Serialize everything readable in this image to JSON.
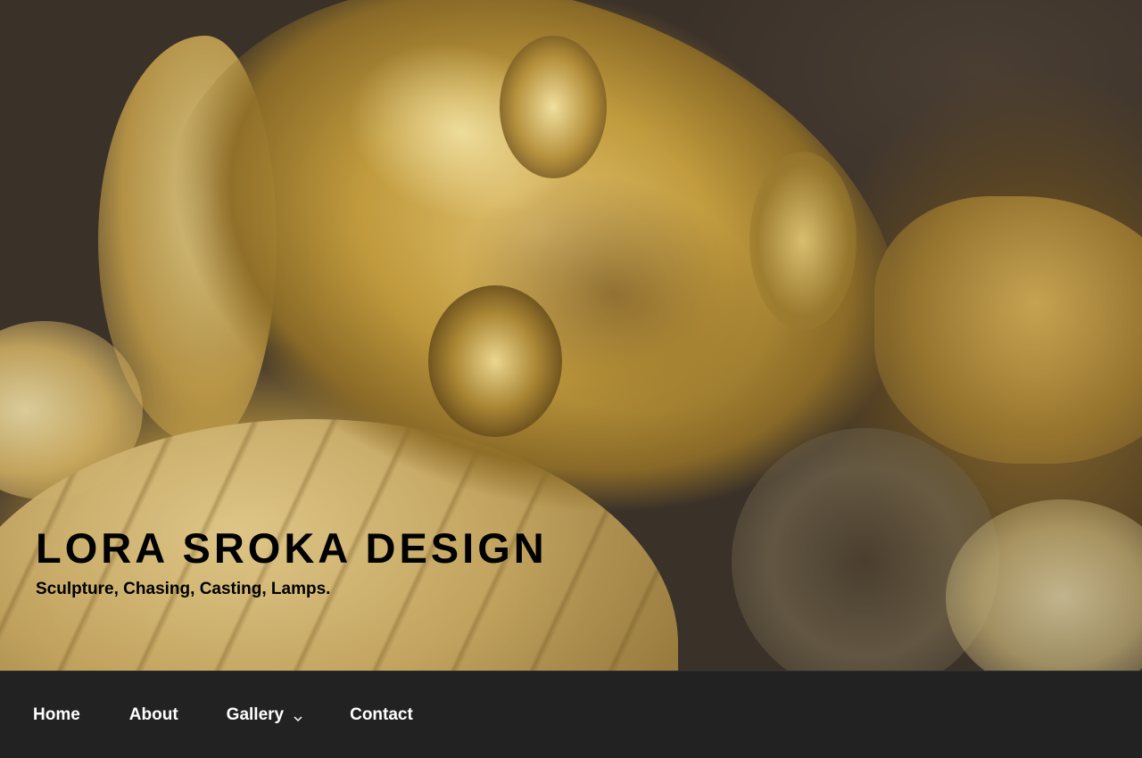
{
  "site": {
    "title": "LORA SROKA DESIGN",
    "tagline": "Sculpture, Chasing, Casting, Lamps."
  },
  "nav": {
    "items": [
      {
        "label": "Home"
      },
      {
        "label": "About"
      },
      {
        "label": "Gallery",
        "has_submenu": true,
        "icon": "chevron-down-icon"
      },
      {
        "label": "Contact"
      }
    ]
  },
  "colors": {
    "nav_background": "#222222",
    "nav_text": "#ffffff",
    "title_text": "#000000"
  },
  "hero": {
    "image": "gold sculpture face header image"
  }
}
